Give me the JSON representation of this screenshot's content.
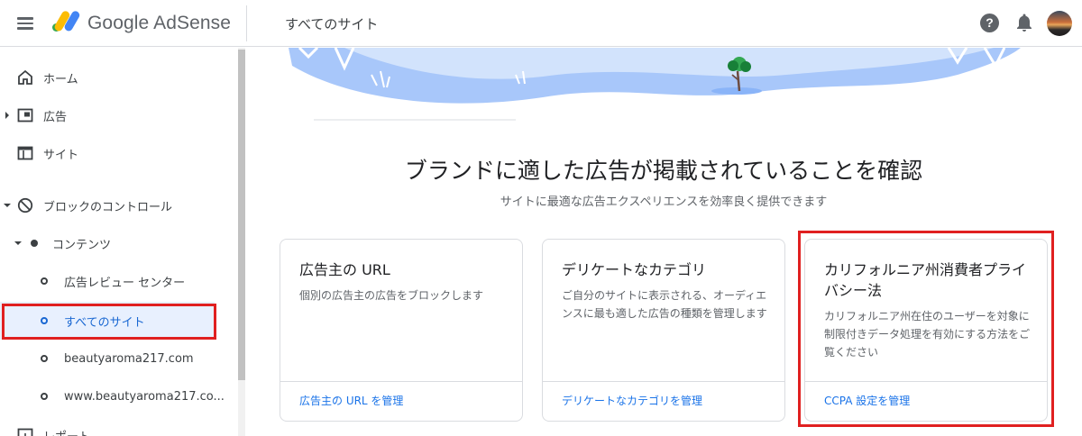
{
  "header": {
    "logo_text": "Google AdSense",
    "page_title": "すべてのサイト",
    "help_label": "?"
  },
  "sidebar": {
    "items": [
      {
        "label": "ホーム",
        "icon": "home-icon"
      },
      {
        "label": "広告",
        "icon": "ads-icon"
      },
      {
        "label": "サイト",
        "icon": "sites-icon"
      },
      {
        "label": "ブロックのコントロール",
        "icon": "block-icon"
      },
      {
        "label": "コンテンツ",
        "icon": "dot-icon"
      },
      {
        "label": "広告レビュー センター",
        "icon": "ring-icon"
      },
      {
        "label": "すべてのサイト",
        "icon": "ring-icon",
        "selected": true
      },
      {
        "label": "beautyaroma217.com",
        "icon": "ring-icon"
      },
      {
        "label": "www.beautyaroma217.co...",
        "icon": "ring-icon"
      },
      {
        "label": "レポート",
        "icon": "reports-icon"
      }
    ]
  },
  "main": {
    "heading": "ブランドに適した広告が掲載されていることを確認",
    "subheading": "サイトに最適な広告エクスペリエンスを効率良く提供できます",
    "cards": [
      {
        "title": "広告主の URL",
        "description": "個別の広告主の広告をブロックします",
        "link": "広告主の URL を管理"
      },
      {
        "title": "デリケートなカテゴリ",
        "description": "ご自分のサイトに表示される、オーディエンスに最も適した広告の種類を管理します",
        "link": "デリケートなカテゴリを管理"
      },
      {
        "title": "カリフォルニア州消費者プライバシー法",
        "description": "カリフォルニア州在住のユーザーを対象に制限付きデータ処理を有効にする方法をご覧ください",
        "link": "CCPA 設定を管理"
      }
    ]
  },
  "colors": {
    "accent": "#1a73e8",
    "selected_bg": "#e8f0fe",
    "highlight_border": "#e02020"
  }
}
